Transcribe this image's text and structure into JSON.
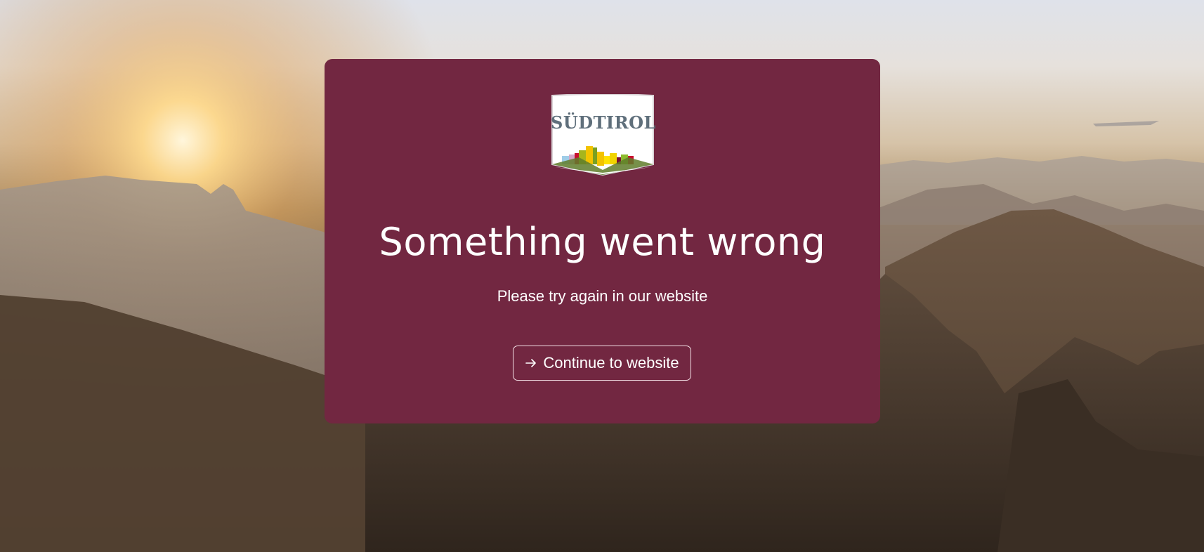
{
  "logo": {
    "wordmark": "SÜDTIROL",
    "icon": "suedtirol-logo"
  },
  "error": {
    "title": "Something went wrong",
    "message": "Please try again in our website"
  },
  "actions": {
    "continue_label": "Continue to website",
    "continue_icon": "arrow-right-icon"
  },
  "colors": {
    "card_background": "#722741",
    "text": "#ffffff"
  }
}
